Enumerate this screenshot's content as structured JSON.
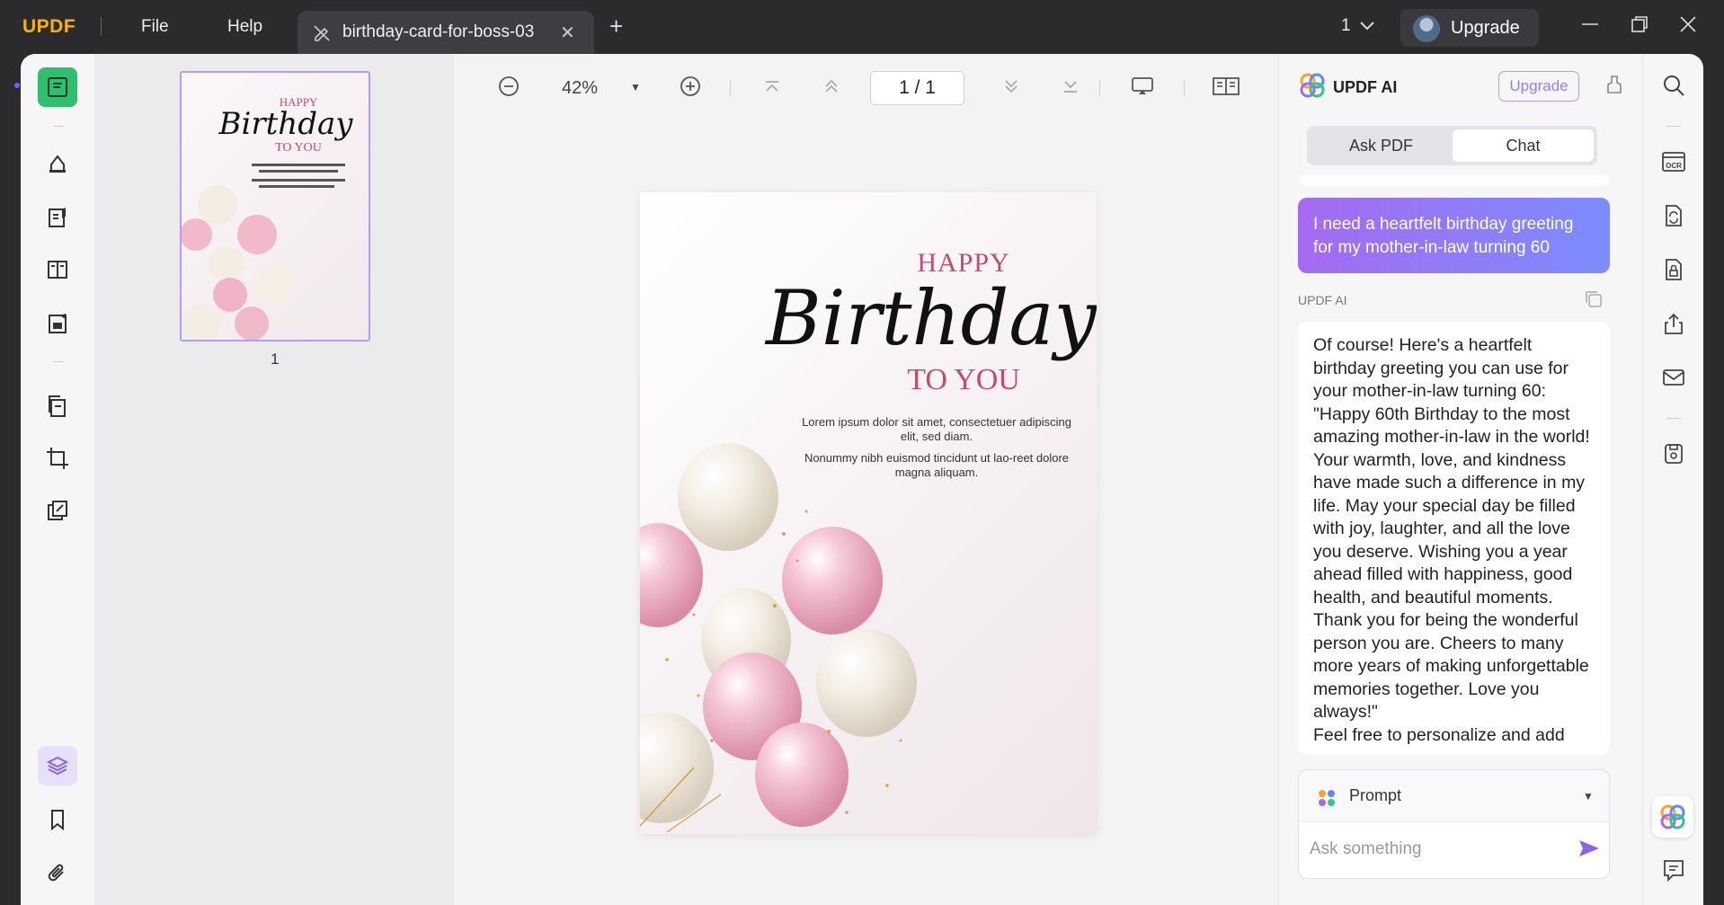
{
  "app": {
    "logo_part1": "UPDF",
    "logo_part2": "",
    "menu": [
      "File",
      "Help"
    ],
    "tab_title": "birthday-card-for-boss-03",
    "window_count": "1",
    "upgrade_label": "Upgrade"
  },
  "toolbar": {
    "zoom": "42%",
    "page_indicator": "1  /  1"
  },
  "thumbnails": {
    "page_number": "1"
  },
  "card": {
    "happy": "HAPPY",
    "birthday": "Birthday",
    "to_you": "TO YOU",
    "lorem1": "Lorem ipsum dolor sit amet, consectetuer adipiscing elit, sed diam.",
    "lorem2": "Nonummy nibh euismod tincidunt ut lao-reet dolore magna aliquam."
  },
  "ai": {
    "title": "UPDF AI",
    "upgrade": "Upgrade",
    "tabs": [
      "Ask PDF",
      "Chat"
    ],
    "active_tab": "Chat",
    "user_message": "I need a heartfelt birthday greeting for my mother-in-law turning 60",
    "assistant_label": "UPDF AI",
    "reply_intro": "Of course! Here's a heartfelt birthday greeting you can use for your mother-in-law turning 60:",
    "reply_quote": "\"Happy 60th Birthday to the most amazing mother-in-law in the world! Your warmth, love, and kindness have made such a difference in my life. May your special day be filled with joy, laughter, and all the love you deserve. Wishing you a year ahead filled with happiness, good health, and beautiful moments. Thank you for being the wonderful person you are. Cheers to many more years of making unforgettable memories together. Love you always!\"",
    "reply_outro": "Feel free to personalize and add",
    "prompt_label": "Prompt",
    "input_placeholder": "Ask something"
  },
  "colors": {
    "accent_purple": "#9b7cf0",
    "active_green": "#2fbf71",
    "card_pink": "#c8496f"
  }
}
